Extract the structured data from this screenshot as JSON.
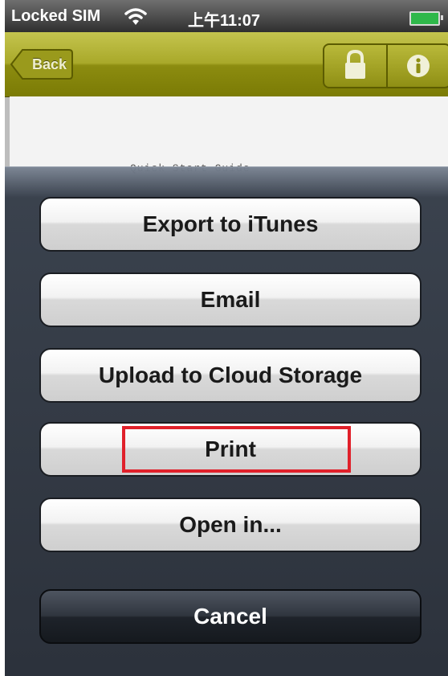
{
  "status_bar": {
    "carrier": "Locked SIM",
    "time": "上午11:07"
  },
  "nav_bar": {
    "back_label": "Back",
    "segment_icons": [
      "lock-icon",
      "info-icon"
    ]
  },
  "document": {
    "title": "Quick Start Guide"
  },
  "action_sheet": {
    "buttons": [
      {
        "label": "Export to iTunes"
      },
      {
        "label": "Email"
      },
      {
        "label": "Upload to Cloud Storage"
      },
      {
        "label": "Print"
      },
      {
        "label": "Open in..."
      }
    ],
    "cancel_label": "Cancel"
  },
  "colors": {
    "nav_accent": "#a9a92a",
    "highlight": "#e0202a",
    "battery": "#2fb84a"
  }
}
